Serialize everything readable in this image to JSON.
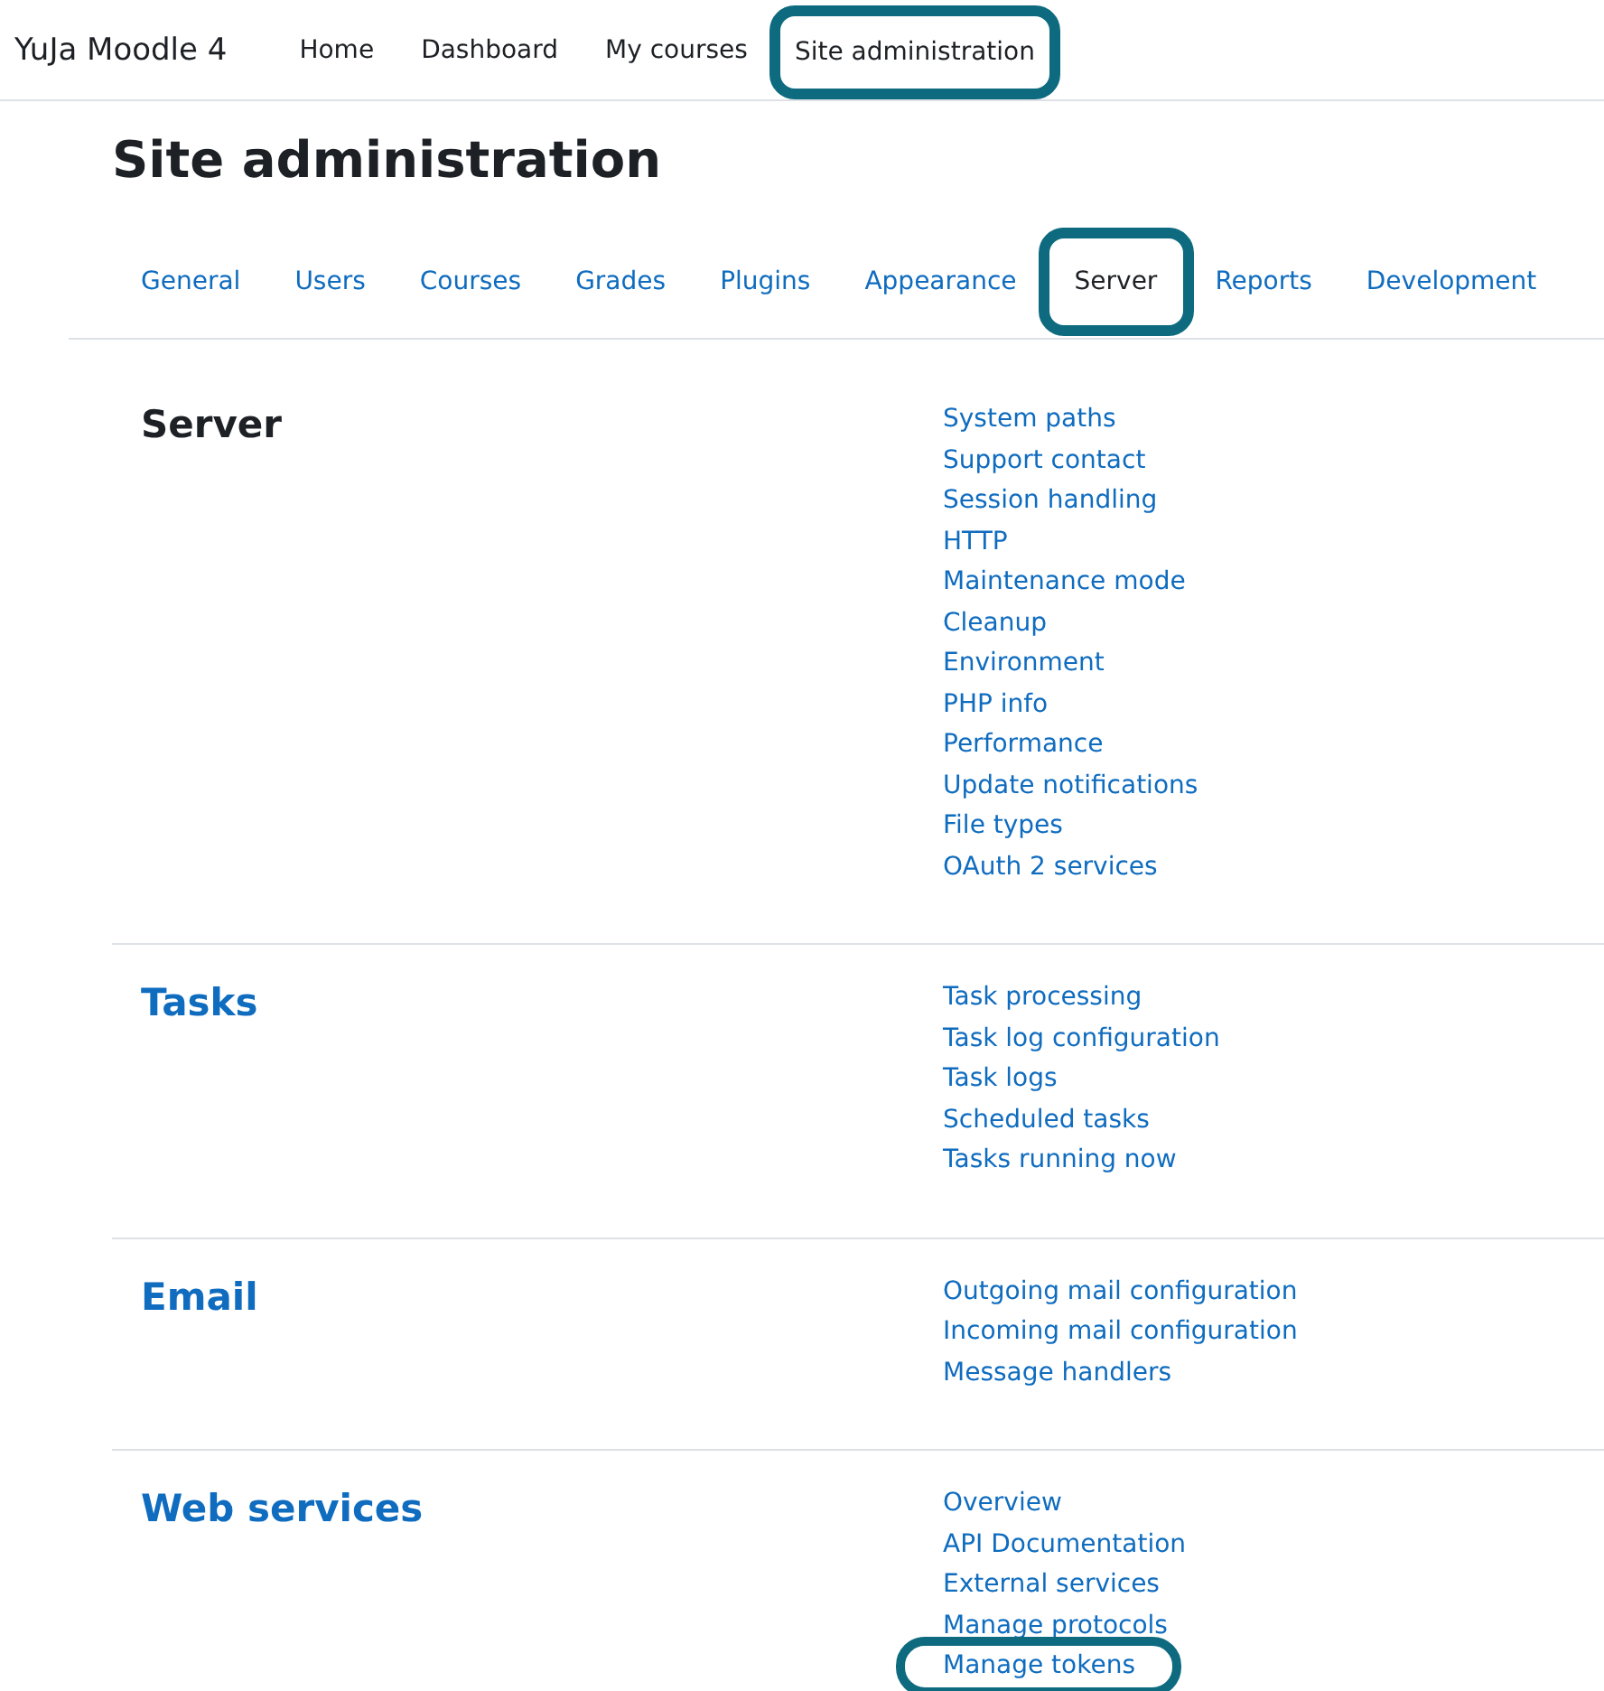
{
  "navbar": {
    "brand": "YuJa Moodle 4",
    "items": [
      {
        "label": "Home",
        "highlighted": false
      },
      {
        "label": "Dashboard",
        "highlighted": false
      },
      {
        "label": "My courses",
        "highlighted": false
      },
      {
        "label": "Site administration",
        "highlighted": true
      }
    ]
  },
  "page_title": "Site administration",
  "tabs": [
    {
      "label": "General",
      "selected": false,
      "highlighted": false
    },
    {
      "label": "Users",
      "selected": false,
      "highlighted": false
    },
    {
      "label": "Courses",
      "selected": false,
      "highlighted": false
    },
    {
      "label": "Grades",
      "selected": false,
      "highlighted": false
    },
    {
      "label": "Plugins",
      "selected": false,
      "highlighted": false
    },
    {
      "label": "Appearance",
      "selected": false,
      "highlighted": false
    },
    {
      "label": "Server",
      "selected": true,
      "highlighted": true
    },
    {
      "label": "Reports",
      "selected": false,
      "highlighted": false
    },
    {
      "label": "Development",
      "selected": false,
      "highlighted": false
    }
  ],
  "sections": [
    {
      "heading": "Server",
      "is_link": false,
      "links": [
        {
          "label": "System paths",
          "highlighted": false
        },
        {
          "label": "Support contact",
          "highlighted": false
        },
        {
          "label": "Session handling",
          "highlighted": false
        },
        {
          "label": "HTTP",
          "highlighted": false
        },
        {
          "label": "Maintenance mode",
          "highlighted": false
        },
        {
          "label": "Cleanup",
          "highlighted": false
        },
        {
          "label": "Environment",
          "highlighted": false
        },
        {
          "label": "PHP info",
          "highlighted": false
        },
        {
          "label": "Performance",
          "highlighted": false
        },
        {
          "label": "Update notifications",
          "highlighted": false
        },
        {
          "label": "File types",
          "highlighted": false
        },
        {
          "label": "OAuth 2 services",
          "highlighted": false
        }
      ]
    },
    {
      "heading": "Tasks",
      "is_link": true,
      "links": [
        {
          "label": "Task processing",
          "highlighted": false
        },
        {
          "label": "Task log configuration",
          "highlighted": false
        },
        {
          "label": "Task logs",
          "highlighted": false
        },
        {
          "label": "Scheduled tasks",
          "highlighted": false
        },
        {
          "label": "Tasks running now",
          "highlighted": false
        }
      ]
    },
    {
      "heading": "Email",
      "is_link": true,
      "links": [
        {
          "label": "Outgoing mail configuration",
          "highlighted": false
        },
        {
          "label": "Incoming mail configuration",
          "highlighted": false
        },
        {
          "label": "Message handlers",
          "highlighted": false
        }
      ]
    },
    {
      "heading": "Web services",
      "is_link": true,
      "links": [
        {
          "label": "Overview",
          "highlighted": false
        },
        {
          "label": "API Documentation",
          "highlighted": false
        },
        {
          "label": "External services",
          "highlighted": false
        },
        {
          "label": "Manage protocols",
          "highlighted": false
        },
        {
          "label": "Manage tokens",
          "highlighted": true
        }
      ]
    }
  ]
}
